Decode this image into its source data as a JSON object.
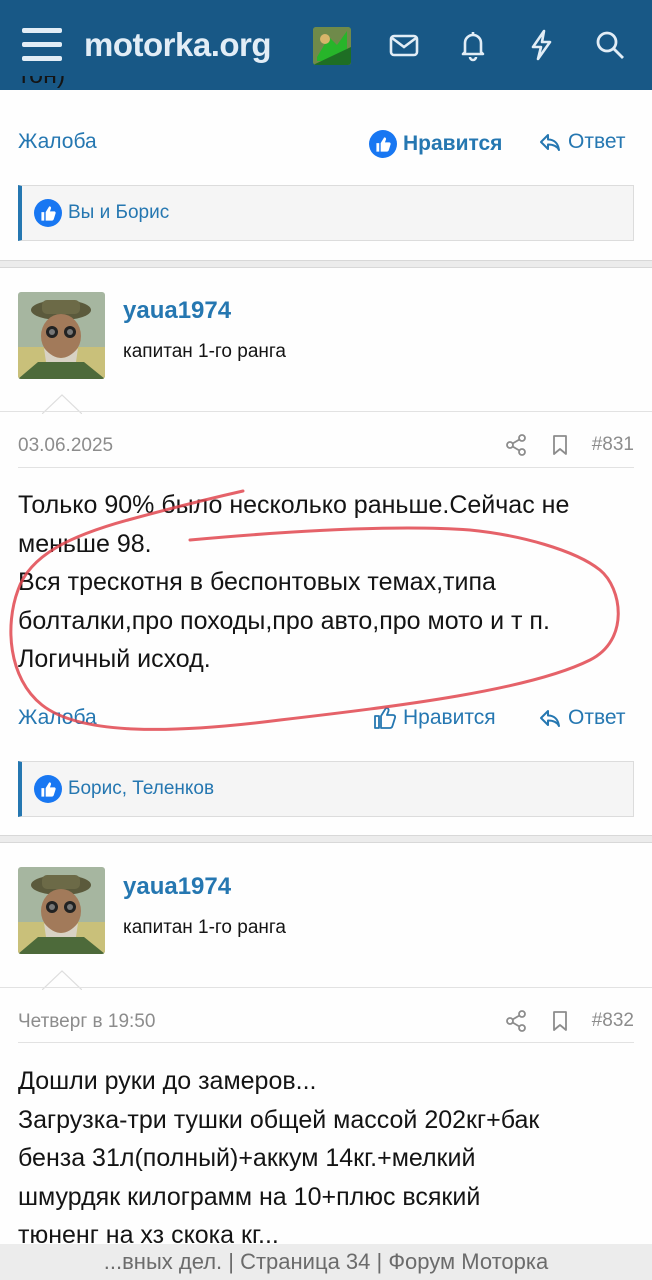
{
  "header": {
    "site_name": "motorka.org",
    "icons": [
      "menu-icon",
      "mail-icon",
      "bell-icon",
      "lightning-icon",
      "search-icon"
    ]
  },
  "prev_post": {
    "cut_text": "тон)",
    "actions": {
      "report": "Жалоба",
      "like": "Нравится",
      "reply": "Ответ"
    },
    "reactions": "Вы и Борис"
  },
  "posts": [
    {
      "author": "yaua1974",
      "rank": "капитан 1-го ранга",
      "date": "03.06.2025",
      "number": "#831",
      "body": [
        "Только 90% было несколько раньше.Сейчас не",
        "меньше 98.",
        "Вся трескотня в беспонтовых темах,типа",
        "болталки,про походы,про авто,про мото и т п.",
        "Логичный исход."
      ],
      "actions": {
        "report": "Жалоба",
        "like": "Нравится",
        "reply": "Ответ"
      },
      "reactions": "Борис, Теленков"
    },
    {
      "author": "yaua1974",
      "rank": "капитан 1-го ранга",
      "date": "Четверг в 19:50",
      "number": "#832",
      "body": [
        "Дошли руки до замеров...",
        "Загрузка-три тушки общей массой 202кг+бак",
        "бенза 31л(полный)+аккум 14кг.+мелкий",
        "шмурдяк килограмм на 10+плюс всякий",
        "тюненг на хз скока кг..."
      ]
    }
  ],
  "footer": {
    "tab_title": "...вных дел. | Страница 34 | Форум Моторка"
  },
  "colors": {
    "header_bg": "#185886",
    "link": "#2577b1",
    "annotation": "#e0474f"
  }
}
